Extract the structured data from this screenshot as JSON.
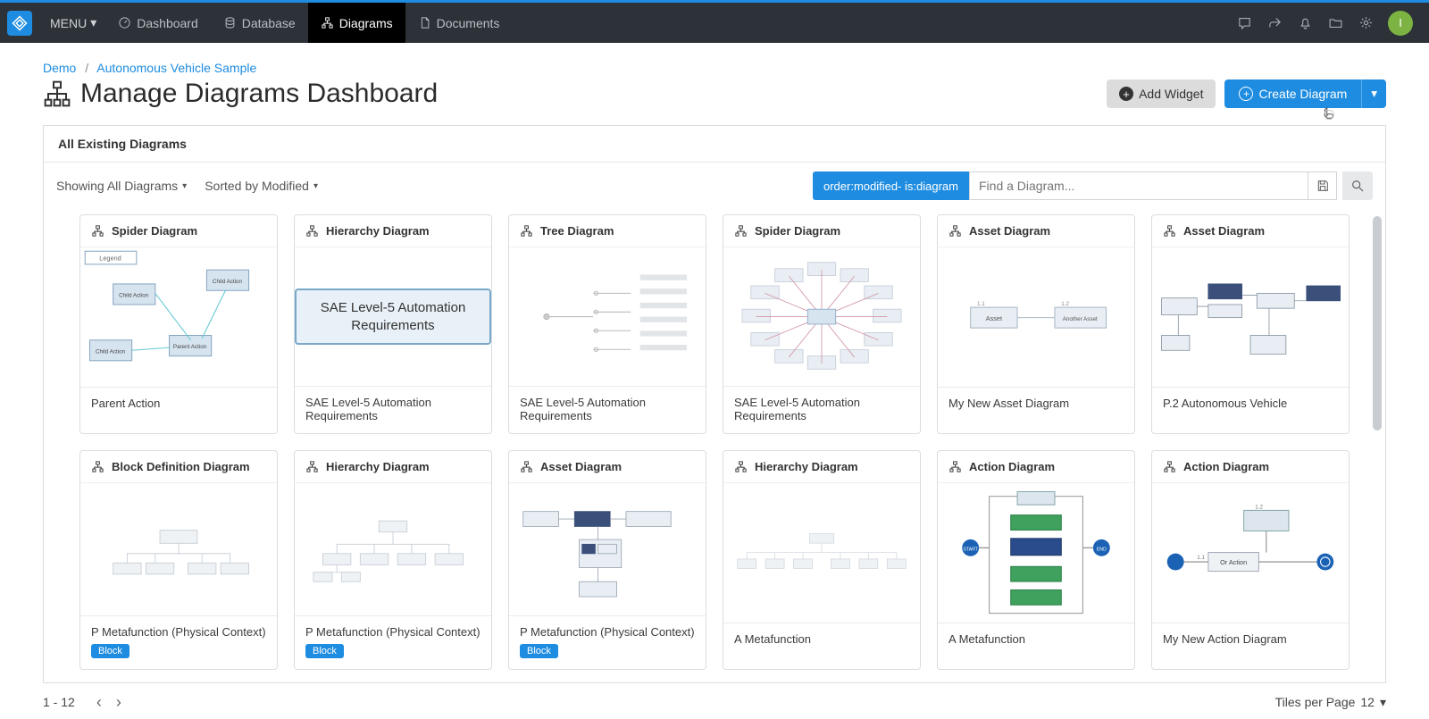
{
  "nav": {
    "menu": "MENU",
    "items": [
      {
        "label": "Dashboard"
      },
      {
        "label": "Database"
      },
      {
        "label": "Diagrams"
      },
      {
        "label": "Documents"
      }
    ],
    "avatar_initial": "I"
  },
  "breadcrumb": {
    "root": "Demo",
    "current": "Autonomous Vehicle Sample"
  },
  "page_title": "Manage Diagrams Dashboard",
  "buttons": {
    "add_widget": "Add Widget",
    "create_diagram": "Create Diagram"
  },
  "panel": {
    "title": "All Existing Diagrams",
    "filter_showing": "Showing All Diagrams",
    "filter_sort": "Sorted by Modified",
    "search_chip": "order:modified- is:diagram",
    "search_placeholder": "Find a Diagram..."
  },
  "cards": [
    {
      "type": "Spider Diagram",
      "name": "Parent Action",
      "chip": null,
      "thumb": "spider1"
    },
    {
      "type": "Hierarchy Diagram",
      "name": "SAE Level-5 Automation Requirements",
      "chip": null,
      "thumb": "sae_box",
      "thumb_label": "SAE Level-5 Automation Requirements"
    },
    {
      "type": "Tree Diagram",
      "name": "SAE Level-5 Automation Requirements",
      "chip": null,
      "thumb": "tree"
    },
    {
      "type": "Spider Diagram",
      "name": "SAE Level-5 Automation Requirements",
      "chip": null,
      "thumb": "spider2"
    },
    {
      "type": "Asset Diagram",
      "name": "My New Asset Diagram",
      "chip": null,
      "thumb": "asset2"
    },
    {
      "type": "Asset Diagram",
      "name": "P.2 Autonomous Vehicle",
      "chip": null,
      "thumb": "asset3"
    },
    {
      "type": "Block Definition Diagram",
      "name": "P Metafunction (Physical Context)",
      "chip": "Block",
      "thumb": "block"
    },
    {
      "type": "Hierarchy Diagram",
      "name": "P Metafunction (Physical Context)",
      "chip": "Block",
      "thumb": "hier"
    },
    {
      "type": "Asset Diagram",
      "name": "P Metafunction (Physical Context)",
      "chip": "Block",
      "thumb": "asset4"
    },
    {
      "type": "Hierarchy Diagram",
      "name": "A Metafunction",
      "chip": null,
      "thumb": "hier2"
    },
    {
      "type": "Action Diagram",
      "name": "A Metafunction",
      "chip": null,
      "thumb": "action1"
    },
    {
      "type": "Action Diagram",
      "name": "My New Action Diagram",
      "chip": null,
      "thumb": "action2"
    }
  ],
  "pager": {
    "range": "1 - 12",
    "tiles_label": "Tiles per Page",
    "tiles_value": "12"
  }
}
